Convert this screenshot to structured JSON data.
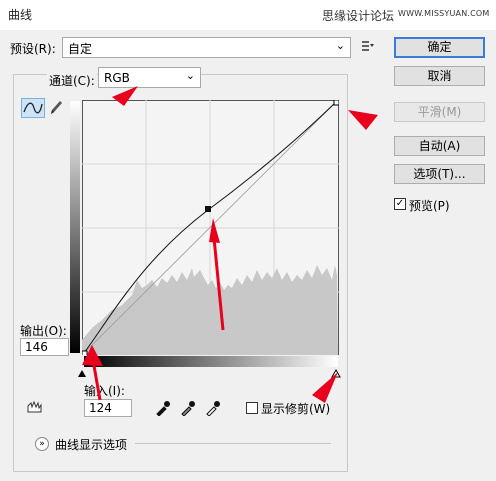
{
  "window": {
    "title": "曲线",
    "watermark_site": "思缘设计论坛",
    "watermark_url": "WWW.MISSYUAN.COM"
  },
  "preset": {
    "label": "预设(R):",
    "value": "自定"
  },
  "channel": {
    "label": "通道(C):",
    "value": "RGB"
  },
  "buttons": {
    "ok": "确定",
    "cancel": "取消",
    "smooth": "平滑(M)",
    "auto": "自动(A)",
    "options": "选项(T)..."
  },
  "preview": {
    "label": "预览(P)",
    "checked": true
  },
  "output": {
    "label": "输出(O):",
    "value": "146"
  },
  "input": {
    "label": "输入(I):",
    "value": "124"
  },
  "clipping": {
    "label": "显示修剪(W)",
    "checked": false
  },
  "curve_options": {
    "label": "曲线显示选项"
  },
  "curve": {
    "points": [
      [
        0,
        0
      ],
      [
        124,
        146
      ],
      [
        255,
        255
      ]
    ],
    "line_color": "#000000"
  },
  "icons": {
    "curve_tool": "curve-point-icon",
    "pencil_tool": "pencil-icon",
    "preset_menu": "list-menu-icon",
    "hand_tool": "hand-icon",
    "black_eyedropper": "eyedropper-black-icon",
    "gray_eyedropper": "eyedropper-gray-icon",
    "white_eyedropper": "eyedropper-white-icon"
  },
  "colors": {
    "accent": "#3a7bd5",
    "annotation": "#e8001c",
    "histogram": "#c8c8c8"
  }
}
